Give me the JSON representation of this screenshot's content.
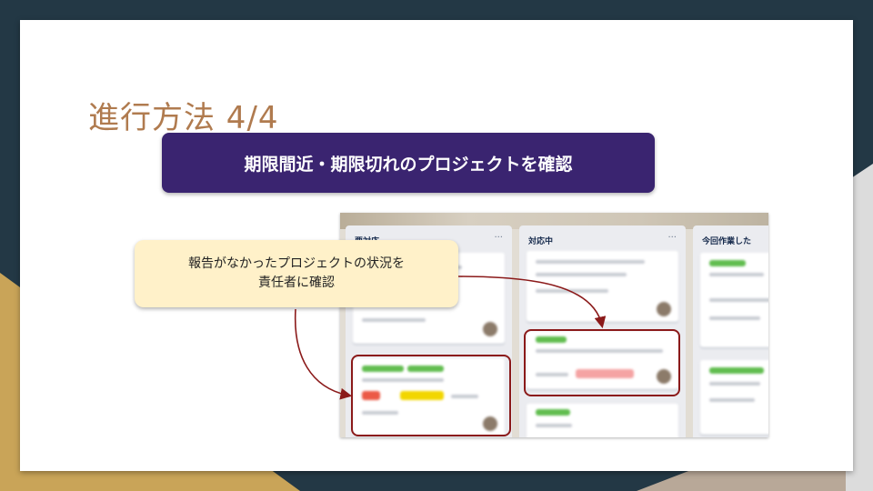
{
  "slide": {
    "title": "進行方法 4/4",
    "banner": "期限間近・期限切れのプロジェクトを確認",
    "note_line1": "報告がなかったプロジェクトの状況を",
    "note_line2": "責任者に確認"
  },
  "board": {
    "columns": [
      {
        "title": "要対応",
        "menu": "···"
      },
      {
        "title": "対応中",
        "menu": "···"
      },
      {
        "title": "今回作業した",
        "menu": ""
      }
    ]
  },
  "colors": {
    "background": "#233845",
    "accent_gold": "#c9a458",
    "banner": "#3a2470",
    "title": "#b07b4f",
    "note": "#fff1c9",
    "highlight": "#8b1a1a"
  }
}
